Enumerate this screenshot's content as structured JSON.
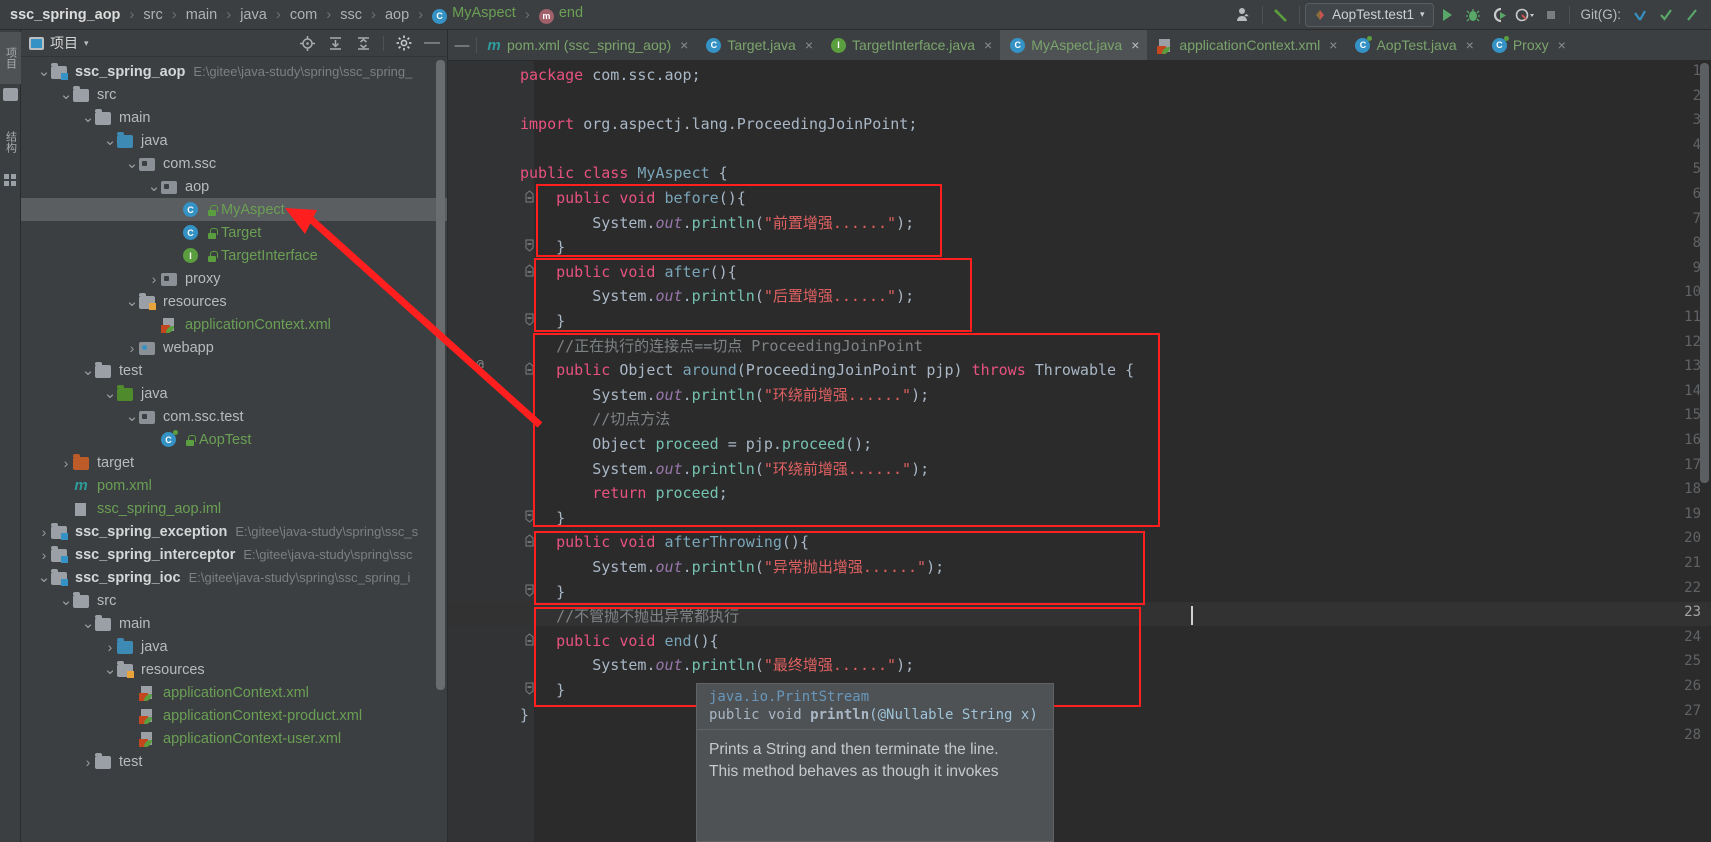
{
  "breadcrumb": {
    "items": [
      {
        "label": "ssc_spring_aop",
        "style": "bold"
      },
      {
        "label": "src",
        "style": "plain"
      },
      {
        "label": "main",
        "style": "plain"
      },
      {
        "label": "java",
        "style": "plain"
      },
      {
        "label": "com",
        "style": "plain"
      },
      {
        "label": "ssc",
        "style": "plain"
      },
      {
        "label": "aop",
        "style": "plain"
      },
      {
        "label": "MyAspect",
        "style": "class",
        "icon": "class-icon",
        "icon_letter": "C"
      },
      {
        "label": "end",
        "style": "method",
        "icon": "method-icon",
        "icon_letter": "m"
      }
    ],
    "separator": "›"
  },
  "toolbar": {
    "user_icon": "user-account-icon",
    "build_icon": "build-hammer-icon",
    "run_config": "AopTest.test1",
    "run_config_caret": "▾",
    "run_icon": "run-play-icon",
    "debug_icon": "debug-bug-icon",
    "coverage_icon": "run-with-coverage-icon",
    "profiler_icon": "profiler-icon",
    "stop_icon": "stop-icon",
    "git_label": "Git(G):",
    "update_icon": "git-update-icon",
    "commit_icon": "git-commit-checkmark-icon",
    "push_icon": "git-push-icon"
  },
  "left_strip": {
    "tabs": [
      {
        "label": "项目",
        "active": true,
        "name": "tool-window-project"
      },
      {
        "label": "结构",
        "active": false,
        "name": "tool-window-structure"
      }
    ]
  },
  "project_panel": {
    "title": "项目",
    "caret": "▾",
    "icons": [
      "locate-icon",
      "expand-all-icon",
      "collapse-all-icon",
      "settings-gear-icon",
      "hide-icon"
    ],
    "minimize": "—",
    "tree": [
      {
        "indent": 0,
        "arrow": "v",
        "icon": "module-folder",
        "label": "ssc_spring_aop",
        "bold": true,
        "path": "E:\\gitee\\java-study\\spring\\ssc_spring_"
      },
      {
        "indent": 1,
        "arrow": "v",
        "icon": "folder-gray",
        "label": "src"
      },
      {
        "indent": 2,
        "arrow": "v",
        "icon": "folder-gray",
        "label": "main"
      },
      {
        "indent": 3,
        "arrow": "v",
        "icon": "folder-blue",
        "label": "java"
      },
      {
        "indent": 4,
        "arrow": "v",
        "icon": "package",
        "label": "com.ssc"
      },
      {
        "indent": 5,
        "arrow": "v",
        "icon": "package",
        "label": "aop"
      },
      {
        "indent": 6,
        "arrow": "none",
        "icon": "class-c",
        "label": "MyAspect",
        "green": true,
        "selected": true,
        "lock": true
      },
      {
        "indent": 6,
        "arrow": "none",
        "icon": "class-c",
        "label": "Target",
        "green": true,
        "lock": true
      },
      {
        "indent": 6,
        "arrow": "none",
        "icon": "interface-i",
        "label": "TargetInterface",
        "green": true,
        "lock": true
      },
      {
        "indent": 5,
        "arrow": ">",
        "icon": "package",
        "label": "proxy"
      },
      {
        "indent": 4,
        "arrow": "v",
        "icon": "folder-resources",
        "label": "resources"
      },
      {
        "indent": 5,
        "arrow": "none",
        "icon": "spring-xml",
        "label": "applicationContext.xml",
        "green": true
      },
      {
        "indent": 4,
        "arrow": ">",
        "icon": "webapp",
        "label": "webapp"
      },
      {
        "indent": 2,
        "arrow": "v",
        "icon": "folder-gray",
        "label": "test"
      },
      {
        "indent": 3,
        "arrow": "v",
        "icon": "folder-green",
        "label": "java"
      },
      {
        "indent": 4,
        "arrow": "v",
        "icon": "package",
        "label": "com.ssc.test"
      },
      {
        "indent": 5,
        "arrow": "none",
        "icon": "test-class",
        "label": "AopTest",
        "green": true,
        "lock": true
      },
      {
        "indent": 1,
        "arrow": ">",
        "icon": "folder-orange",
        "label": "target"
      },
      {
        "indent": 1,
        "arrow": "none",
        "icon": "maven-m",
        "label": "pom.xml",
        "green": true
      },
      {
        "indent": 1,
        "arrow": "none",
        "icon": "iml",
        "label": "ssc_spring_aop.iml",
        "green": true
      },
      {
        "indent": 0,
        "arrow": ">",
        "icon": "module-folder",
        "label": "ssc_spring_exception",
        "bold": true,
        "path": "E:\\gitee\\java-study\\spring\\ssc_s"
      },
      {
        "indent": 0,
        "arrow": ">",
        "icon": "module-folder",
        "label": "ssc_spring_interceptor",
        "bold": true,
        "path": "E:\\gitee\\java-study\\spring\\ssc"
      },
      {
        "indent": 0,
        "arrow": "v",
        "icon": "module-folder",
        "label": "ssc_spring_ioc",
        "bold": true,
        "path": "E:\\gitee\\java-study\\spring\\ssc_spring_i"
      },
      {
        "indent": 1,
        "arrow": "v",
        "icon": "folder-gray",
        "label": "src"
      },
      {
        "indent": 2,
        "arrow": "v",
        "icon": "folder-gray",
        "label": "main"
      },
      {
        "indent": 3,
        "arrow": ">",
        "icon": "folder-blue",
        "label": "java"
      },
      {
        "indent": 3,
        "arrow": "v",
        "icon": "folder-resources",
        "label": "resources"
      },
      {
        "indent": 4,
        "arrow": "none",
        "icon": "spring-xml",
        "label": "applicationContext.xml",
        "green": true
      },
      {
        "indent": 4,
        "arrow": "none",
        "icon": "spring-xml",
        "label": "applicationContext-product.xml",
        "green": true
      },
      {
        "indent": 4,
        "arrow": "none",
        "icon": "spring-xml",
        "label": "applicationContext-user.xml",
        "green": true
      },
      {
        "indent": 2,
        "arrow": ">",
        "icon": "folder-gray",
        "label": "test"
      }
    ]
  },
  "editor_tabs": [
    {
      "label": "pom.xml (ssc_spring_aop)",
      "icon": "maven-icon",
      "active": false
    },
    {
      "label": "Target.java",
      "icon": "class-icon",
      "active": false
    },
    {
      "label": "TargetInterface.java",
      "icon": "interface-icon",
      "active": false
    },
    {
      "label": "MyAspect.java",
      "icon": "class-icon",
      "active": true
    },
    {
      "label": "applicationContext.xml",
      "icon": "spring-xml-icon",
      "active": false
    },
    {
      "label": "AopTest.java",
      "icon": "test-class-icon",
      "active": false
    },
    {
      "label": "Proxy",
      "icon": "test-class-icon",
      "active": false
    }
  ],
  "code": {
    "current_line": 23,
    "lines": [
      {
        "n": 1,
        "text": "package com.ssc.aop;"
      },
      {
        "n": 2,
        "text": ""
      },
      {
        "n": 3,
        "text": "import org.aspectj.lang.ProceedingJoinPoint;"
      },
      {
        "n": 4,
        "text": ""
      },
      {
        "n": 5,
        "text": "public class MyAspect {"
      },
      {
        "n": 6,
        "text": "    public void before(){"
      },
      {
        "n": 7,
        "text": "        System.out.println(\"前置增强......\");"
      },
      {
        "n": 8,
        "text": "    }"
      },
      {
        "n": 9,
        "text": "    public void after(){"
      },
      {
        "n": 10,
        "text": "        System.out.println(\"后置增强......\");"
      },
      {
        "n": 11,
        "text": "    }"
      },
      {
        "n": 12,
        "text": "    //正在执行的连接点==切点 ProceedingJoinPoint"
      },
      {
        "n": 13,
        "text": "    public Object around(ProceedingJoinPoint pjp) throws Throwable {",
        "annotation": "@"
      },
      {
        "n": 14,
        "text": "        System.out.println(\"环绕前增强......\");"
      },
      {
        "n": 15,
        "text": "        //切点方法"
      },
      {
        "n": 16,
        "text": "        Object proceed = pjp.proceed();"
      },
      {
        "n": 17,
        "text": "        System.out.println(\"环绕前增强......\");"
      },
      {
        "n": 18,
        "text": "        return proceed;"
      },
      {
        "n": 19,
        "text": "    }"
      },
      {
        "n": 20,
        "text": "    public void afterThrowing(){"
      },
      {
        "n": 21,
        "text": "        System.out.println(\"异常抛出增强......\");"
      },
      {
        "n": 22,
        "text": "    }"
      },
      {
        "n": 23,
        "text": "    //不管抛不抛出异常都执行"
      },
      {
        "n": 24,
        "text": "    public void end(){"
      },
      {
        "n": 25,
        "text": "        System.out.println(\"最终增强......\");"
      },
      {
        "n": 26,
        "text": "    }"
      },
      {
        "n": 27,
        "text": "}"
      },
      {
        "n": 28,
        "text": ""
      }
    ]
  },
  "doc_popup": {
    "qualified_name": "java.io.PrintStream",
    "signature_prefix": "public void ",
    "signature_name": "println",
    "signature_args": "(@Nullable String x)",
    "body_line1": "Prints a String and then terminate the line.",
    "body_line2": "This method behaves as though it invokes"
  },
  "colors": {
    "accent_red": "#ff1f1f",
    "keyword": "#cc7832",
    "string": "#de6060",
    "comment": "#7e8386",
    "background": "#2b2b2b",
    "panel": "#3c3f41",
    "green_text": "#6a9f54"
  }
}
